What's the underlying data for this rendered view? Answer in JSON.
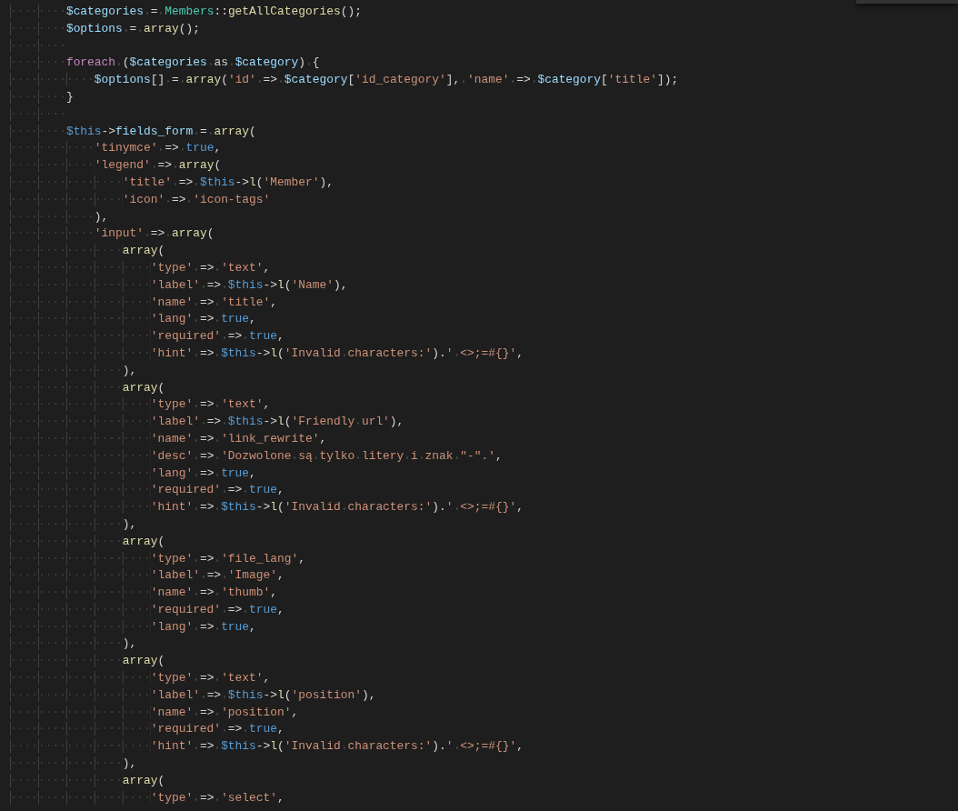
{
  "editor": {
    "lines": [
      {
        "indent": "········",
        "tokens": [
          {
            "kind": "var",
            "text": "$categories"
          },
          {
            "kind": "punc",
            "text": " = "
          },
          {
            "kind": "class",
            "text": "Members"
          },
          {
            "kind": "punc",
            "text": "::"
          },
          {
            "kind": "fn",
            "text": "getAllCategories"
          },
          {
            "kind": "punc",
            "text": "();"
          }
        ]
      },
      {
        "indent": "········",
        "tokens": [
          {
            "kind": "var",
            "text": "$options"
          },
          {
            "kind": "punc",
            "text": " = "
          },
          {
            "kind": "fn",
            "text": "array"
          },
          {
            "kind": "punc",
            "text": "();"
          }
        ]
      },
      {
        "indent": "········"
      },
      {
        "indent": "········",
        "tokens": [
          {
            "kind": "kw",
            "text": "foreach"
          },
          {
            "kind": "punc",
            "text": " ("
          },
          {
            "kind": "var",
            "text": "$categories"
          },
          {
            "kind": "punc",
            "text": " as "
          },
          {
            "kind": "var",
            "text": "$category"
          },
          {
            "kind": "punc",
            "text": ") {"
          }
        ]
      },
      {
        "indent": "············",
        "tokens": [
          {
            "kind": "var",
            "text": "$options"
          },
          {
            "kind": "punc",
            "text": "[] = "
          },
          {
            "kind": "fn",
            "text": "array"
          },
          {
            "kind": "punc",
            "text": "("
          },
          {
            "kind": "str",
            "text": "'id'"
          },
          {
            "kind": "punc",
            "text": " => "
          },
          {
            "kind": "var",
            "text": "$category"
          },
          {
            "kind": "punc",
            "text": "["
          },
          {
            "kind": "str",
            "text": "'id_category'"
          },
          {
            "kind": "punc",
            "text": "], "
          },
          {
            "kind": "str",
            "text": "'name'"
          },
          {
            "kind": "punc",
            "text": " => "
          },
          {
            "kind": "var",
            "text": "$category"
          },
          {
            "kind": "punc",
            "text": "["
          },
          {
            "kind": "str",
            "text": "'title'"
          },
          {
            "kind": "punc",
            "text": "]);"
          }
        ]
      },
      {
        "indent": "········",
        "tokens": [
          {
            "kind": "punc",
            "text": "}"
          }
        ]
      },
      {
        "indent": "········"
      },
      {
        "indent": "········",
        "tokens": [
          {
            "kind": "this",
            "text": "$this"
          },
          {
            "kind": "punc",
            "text": "->"
          },
          {
            "kind": "var",
            "text": "fields_form"
          },
          {
            "kind": "punc",
            "text": " = "
          },
          {
            "kind": "fn",
            "text": "array"
          },
          {
            "kind": "punc",
            "text": "("
          }
        ]
      },
      {
        "indent": "············",
        "tokens": [
          {
            "kind": "str",
            "text": "'tinymce'"
          },
          {
            "kind": "punc",
            "text": " => "
          },
          {
            "kind": "const",
            "text": "true"
          },
          {
            "kind": "punc",
            "text": ","
          }
        ]
      },
      {
        "indent": "············",
        "tokens": [
          {
            "kind": "str",
            "text": "'legend'"
          },
          {
            "kind": "punc",
            "text": " => "
          },
          {
            "kind": "fn",
            "text": "array"
          },
          {
            "kind": "punc",
            "text": "("
          }
        ]
      },
      {
        "indent": "················",
        "tokens": [
          {
            "kind": "str",
            "text": "'title'"
          },
          {
            "kind": "punc",
            "text": " => "
          },
          {
            "kind": "this",
            "text": "$this"
          },
          {
            "kind": "punc",
            "text": "->"
          },
          {
            "kind": "fn",
            "text": "l"
          },
          {
            "kind": "punc",
            "text": "("
          },
          {
            "kind": "str",
            "text": "'Member'"
          },
          {
            "kind": "punc",
            "text": "),"
          }
        ]
      },
      {
        "indent": "················",
        "tokens": [
          {
            "kind": "str",
            "text": "'icon'"
          },
          {
            "kind": "punc",
            "text": " => "
          },
          {
            "kind": "str",
            "text": "'icon-tags'"
          }
        ]
      },
      {
        "indent": "············",
        "tokens": [
          {
            "kind": "punc",
            "text": "),"
          }
        ]
      },
      {
        "indent": "············",
        "tokens": [
          {
            "kind": "str",
            "text": "'input'"
          },
          {
            "kind": "punc",
            "text": " => "
          },
          {
            "kind": "fn",
            "text": "array"
          },
          {
            "kind": "punc",
            "text": "("
          }
        ]
      },
      {
        "indent": "················",
        "tokens": [
          {
            "kind": "fn",
            "text": "array"
          },
          {
            "kind": "punc",
            "text": "("
          }
        ]
      },
      {
        "indent": "····················",
        "tokens": [
          {
            "kind": "str",
            "text": "'type'"
          },
          {
            "kind": "punc",
            "text": " => "
          },
          {
            "kind": "str",
            "text": "'text'"
          },
          {
            "kind": "punc",
            "text": ","
          }
        ]
      },
      {
        "indent": "····················",
        "tokens": [
          {
            "kind": "str",
            "text": "'label'"
          },
          {
            "kind": "punc",
            "text": " => "
          },
          {
            "kind": "this",
            "text": "$this"
          },
          {
            "kind": "punc",
            "text": "->"
          },
          {
            "kind": "fn",
            "text": "l"
          },
          {
            "kind": "punc",
            "text": "("
          },
          {
            "kind": "str",
            "text": "'Name'"
          },
          {
            "kind": "punc",
            "text": "),"
          }
        ]
      },
      {
        "indent": "····················",
        "tokens": [
          {
            "kind": "str",
            "text": "'name'"
          },
          {
            "kind": "punc",
            "text": " => "
          },
          {
            "kind": "str",
            "text": "'title'"
          },
          {
            "kind": "punc",
            "text": ","
          }
        ]
      },
      {
        "indent": "····················",
        "tokens": [
          {
            "kind": "str",
            "text": "'lang'"
          },
          {
            "kind": "punc",
            "text": " => "
          },
          {
            "kind": "const",
            "text": "true"
          },
          {
            "kind": "punc",
            "text": ","
          }
        ]
      },
      {
        "indent": "····················",
        "tokens": [
          {
            "kind": "str",
            "text": "'required'"
          },
          {
            "kind": "punc",
            "text": " => "
          },
          {
            "kind": "const",
            "text": "true"
          },
          {
            "kind": "punc",
            "text": ","
          }
        ]
      },
      {
        "indent": "····················",
        "tokens": [
          {
            "kind": "str",
            "text": "'hint'"
          },
          {
            "kind": "punc",
            "text": " => "
          },
          {
            "kind": "this",
            "text": "$this"
          },
          {
            "kind": "punc",
            "text": "->"
          },
          {
            "kind": "fn",
            "text": "l"
          },
          {
            "kind": "punc",
            "text": "("
          },
          {
            "kind": "str",
            "text": "'Invalid characters:'"
          },
          {
            "kind": "punc",
            "text": ")."
          },
          {
            "kind": "str",
            "text": "' <>;=#{}'"
          },
          {
            "kind": "punc",
            "text": ","
          }
        ]
      },
      {
        "indent": "················",
        "tokens": [
          {
            "kind": "punc",
            "text": "),"
          }
        ]
      },
      {
        "indent": "················",
        "tokens": [
          {
            "kind": "fn",
            "text": "array"
          },
          {
            "kind": "punc",
            "text": "("
          }
        ]
      },
      {
        "indent": "····················",
        "tokens": [
          {
            "kind": "str",
            "text": "'type'"
          },
          {
            "kind": "punc",
            "text": " => "
          },
          {
            "kind": "str",
            "text": "'text'"
          },
          {
            "kind": "punc",
            "text": ","
          }
        ]
      },
      {
        "indent": "····················",
        "tokens": [
          {
            "kind": "str",
            "text": "'label'"
          },
          {
            "kind": "punc",
            "text": " => "
          },
          {
            "kind": "this",
            "text": "$this"
          },
          {
            "kind": "punc",
            "text": "->"
          },
          {
            "kind": "fn",
            "text": "l"
          },
          {
            "kind": "punc",
            "text": "("
          },
          {
            "kind": "str",
            "text": "'Friendly url'"
          },
          {
            "kind": "punc",
            "text": "),"
          }
        ]
      },
      {
        "indent": "····················",
        "tokens": [
          {
            "kind": "str",
            "text": "'name'"
          },
          {
            "kind": "punc",
            "text": " => "
          },
          {
            "kind": "str",
            "text": "'link_rewrite'"
          },
          {
            "kind": "punc",
            "text": ","
          }
        ]
      },
      {
        "indent": "····················",
        "tokens": [
          {
            "kind": "str",
            "text": "'desc'"
          },
          {
            "kind": "punc",
            "text": " => "
          },
          {
            "kind": "str",
            "text": "'Dozwolone są tylko litery i znak \"-\".'"
          },
          {
            "kind": "punc",
            "text": ","
          }
        ]
      },
      {
        "indent": "····················",
        "tokens": [
          {
            "kind": "str",
            "text": "'lang'"
          },
          {
            "kind": "punc",
            "text": " => "
          },
          {
            "kind": "const",
            "text": "true"
          },
          {
            "kind": "punc",
            "text": ","
          }
        ]
      },
      {
        "indent": "····················",
        "tokens": [
          {
            "kind": "str",
            "text": "'required'"
          },
          {
            "kind": "punc",
            "text": " => "
          },
          {
            "kind": "const",
            "text": "true"
          },
          {
            "kind": "punc",
            "text": ","
          }
        ]
      },
      {
        "indent": "····················",
        "tokens": [
          {
            "kind": "str",
            "text": "'hint'"
          },
          {
            "kind": "punc",
            "text": " => "
          },
          {
            "kind": "this",
            "text": "$this"
          },
          {
            "kind": "punc",
            "text": "->"
          },
          {
            "kind": "fn",
            "text": "l"
          },
          {
            "kind": "punc",
            "text": "("
          },
          {
            "kind": "str",
            "text": "'Invalid characters:'"
          },
          {
            "kind": "punc",
            "text": ")."
          },
          {
            "kind": "str",
            "text": "' <>;=#{}'"
          },
          {
            "kind": "punc",
            "text": ","
          }
        ]
      },
      {
        "indent": "················",
        "tokens": [
          {
            "kind": "punc",
            "text": "),"
          }
        ]
      },
      {
        "indent": "················",
        "tokens": [
          {
            "kind": "fn",
            "text": "array"
          },
          {
            "kind": "punc",
            "text": "("
          }
        ]
      },
      {
        "indent": "····················",
        "tokens": [
          {
            "kind": "str",
            "text": "'type'"
          },
          {
            "kind": "punc",
            "text": " => "
          },
          {
            "kind": "str",
            "text": "'file_lang'"
          },
          {
            "kind": "punc",
            "text": ","
          }
        ]
      },
      {
        "indent": "····················",
        "tokens": [
          {
            "kind": "str",
            "text": "'label'"
          },
          {
            "kind": "punc",
            "text": " => "
          },
          {
            "kind": "str",
            "text": "'Image'"
          },
          {
            "kind": "punc",
            "text": ","
          }
        ]
      },
      {
        "indent": "····················",
        "tokens": [
          {
            "kind": "str",
            "text": "'name'"
          },
          {
            "kind": "punc",
            "text": " => "
          },
          {
            "kind": "str",
            "text": "'thumb'"
          },
          {
            "kind": "punc",
            "text": ","
          }
        ]
      },
      {
        "indent": "····················",
        "tokens": [
          {
            "kind": "str",
            "text": "'required'"
          },
          {
            "kind": "punc",
            "text": " => "
          },
          {
            "kind": "const",
            "text": "true"
          },
          {
            "kind": "punc",
            "text": ","
          }
        ]
      },
      {
        "indent": "····················",
        "tokens": [
          {
            "kind": "str",
            "text": "'lang'"
          },
          {
            "kind": "punc",
            "text": " => "
          },
          {
            "kind": "const",
            "text": "true"
          },
          {
            "kind": "punc",
            "text": ","
          }
        ]
      },
      {
        "indent": "················",
        "tokens": [
          {
            "kind": "punc",
            "text": "),"
          }
        ]
      },
      {
        "indent": "················",
        "tokens": [
          {
            "kind": "fn",
            "text": "array"
          },
          {
            "kind": "punc",
            "text": "("
          }
        ]
      },
      {
        "indent": "····················",
        "tokens": [
          {
            "kind": "str",
            "text": "'type'"
          },
          {
            "kind": "punc",
            "text": " => "
          },
          {
            "kind": "str",
            "text": "'text'"
          },
          {
            "kind": "punc",
            "text": ","
          }
        ]
      },
      {
        "indent": "····················",
        "tokens": [
          {
            "kind": "str",
            "text": "'label'"
          },
          {
            "kind": "punc",
            "text": " => "
          },
          {
            "kind": "this",
            "text": "$this"
          },
          {
            "kind": "punc",
            "text": "->"
          },
          {
            "kind": "fn",
            "text": "l"
          },
          {
            "kind": "punc",
            "text": "("
          },
          {
            "kind": "str",
            "text": "'position'"
          },
          {
            "kind": "punc",
            "text": "),"
          }
        ]
      },
      {
        "indent": "····················",
        "tokens": [
          {
            "kind": "str",
            "text": "'name'"
          },
          {
            "kind": "punc",
            "text": " => "
          },
          {
            "kind": "str",
            "text": "'position'"
          },
          {
            "kind": "punc",
            "text": ","
          }
        ]
      },
      {
        "indent": "····················",
        "tokens": [
          {
            "kind": "str",
            "text": "'required'"
          },
          {
            "kind": "punc",
            "text": " => "
          },
          {
            "kind": "const",
            "text": "true"
          },
          {
            "kind": "punc",
            "text": ","
          }
        ]
      },
      {
        "indent": "····················",
        "tokens": [
          {
            "kind": "str",
            "text": "'hint'"
          },
          {
            "kind": "punc",
            "text": " => "
          },
          {
            "kind": "this",
            "text": "$this"
          },
          {
            "kind": "punc",
            "text": "->"
          },
          {
            "kind": "fn",
            "text": "l"
          },
          {
            "kind": "punc",
            "text": "("
          },
          {
            "kind": "str",
            "text": "'Invalid characters:'"
          },
          {
            "kind": "punc",
            "text": ")."
          },
          {
            "kind": "str",
            "text": "' <>;=#{}'"
          },
          {
            "kind": "punc",
            "text": ","
          }
        ]
      },
      {
        "indent": "················",
        "tokens": [
          {
            "kind": "punc",
            "text": "),"
          }
        ]
      },
      {
        "indent": "················",
        "tokens": [
          {
            "kind": "fn",
            "text": "array"
          },
          {
            "kind": "punc",
            "text": "("
          }
        ]
      },
      {
        "indent": "····················",
        "tokens": [
          {
            "kind": "str",
            "text": "'type'"
          },
          {
            "kind": "punc",
            "text": " => "
          },
          {
            "kind": "str",
            "text": "'select'"
          },
          {
            "kind": "punc",
            "text": ","
          }
        ]
      }
    ]
  }
}
